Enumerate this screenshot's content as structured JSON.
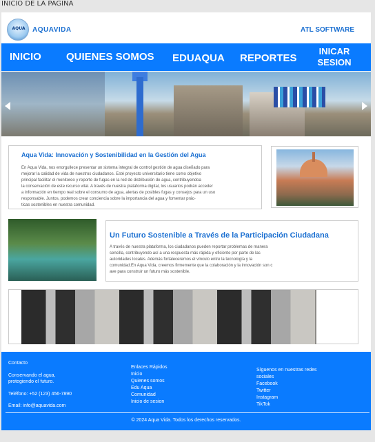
{
  "top_label": "INICIO DE LA PAGINA",
  "header": {
    "logo_text": "AQUA",
    "brand": "AQUAVIDA",
    "company": "ATL SOFTWARE"
  },
  "nav": {
    "items": [
      {
        "label": "INICIO"
      },
      {
        "label": "QUIENES SOMOS"
      },
      {
        "label": "EDUAQUA"
      },
      {
        "label": "REPORTES"
      },
      {
        "label": "INICAR",
        "label2": "SESION"
      }
    ]
  },
  "section1": {
    "title": "Aqua Vida: Innovación y Sostenibilidad en la Gestión del Agua",
    "lines": [
      "En Aqua Vida, nos enorgullece presentar un sistema integral de control gestión de agua diseñado para",
      "mejorar la calidad de vida de nuestros   ciudadanos. Esté proyecto universitario tiene como objetivo",
      "principal facilitar el monitoreo y reporte de fugas en la red de distribución de agua, contribuyendoa",
      "la conservación de este recurso vital. A través de nuestra plataforma digital, los usuarios podrán acceder",
      " a información en tiempo real sobre el consumo de agua, alertas de posibles fugas y consejos para un uso",
      "responsable. Juntos, podemos crear conciencia sobre la importancia del agua y fomentar prác-",
      "ticas sostenibles en nuestra comunidad."
    ]
  },
  "section2": {
    "title": "Un Futuro Sostenible a Través de la Participación Ciudadana",
    "lines": [
      "A través de nuestra plataforma, los ciudadanos pueden reportar problemas de manera",
      "sencilla, contribuyendo así a una respuesta  más rápida y eficiente por parte de las",
      "autoridades locales. Además fortaleceremos  el vínculo entre la tecnología y la",
      "comunidad.En Aqua Vida, creemos firmemente que la colaboración y la innovación son c",
      " ave para  construir un futuro más sostenible."
    ]
  },
  "footer": {
    "contact_title": "Contacto",
    "contact_tag1": "Conservando el agua,",
    "contact_tag2": "protegiendo el futuro.",
    "phone": "Teléfono: +52 (123) 456-7890",
    "email": "Email: info@aquavida.com",
    "links_title": "Enlaces Rápidos",
    "links": [
      "Inicio",
      "Quienes somos",
      "Edu Aqua",
      "Comunidad",
      "Inicio de sesion"
    ],
    "social_title1": "Síguenos en nuestras redes",
    "social_title2": "sociales",
    "social": [
      "Facebook",
      "Twitter",
      "Instagram",
      "TikTok"
    ],
    "copyright": "© 2024 Aqua Vida. Todos los derechos reservados."
  },
  "colors": {
    "accent": "#0a7bff",
    "title_blue": "#1a6fd1"
  }
}
